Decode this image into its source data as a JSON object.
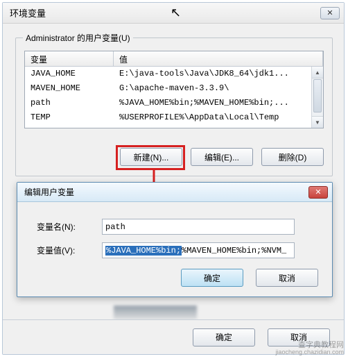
{
  "main": {
    "title": "环境变量",
    "group_label": "Administrator 的用户变量(U)",
    "columns": {
      "var": "变量",
      "val": "值"
    },
    "rows": [
      {
        "var": "JAVA_HOME",
        "val": "E:\\java-tools\\Java\\JDK8_64\\jdk1..."
      },
      {
        "var": "MAVEN_HOME",
        "val": "G:\\apache-maven-3.3.9\\"
      },
      {
        "var": "path",
        "val": "%JAVA_HOME%bin;%MAVEN_HOME%bin;..."
      },
      {
        "var": "TEMP",
        "val": "%USERPROFILE%\\AppData\\Local\\Temp"
      }
    ],
    "buttons": {
      "new": "新建(N)...",
      "edit": "编辑(E)...",
      "delete": "删除(D)"
    },
    "ok": "确定",
    "cancel": "取消"
  },
  "sub": {
    "title": "编辑用户变量",
    "name_label": "变量名(N):",
    "value_label": "变量值(V):",
    "name_value": "path",
    "value_selected": "%JAVA_HOME%bin;",
    "value_rest": "%MAVEN_HOME%bin;%NVM_",
    "ok": "确定",
    "cancel": "取消"
  },
  "watermark": {
    "line1": "查字典教程网",
    "line2": "jiaocheng.chazidian.com"
  }
}
